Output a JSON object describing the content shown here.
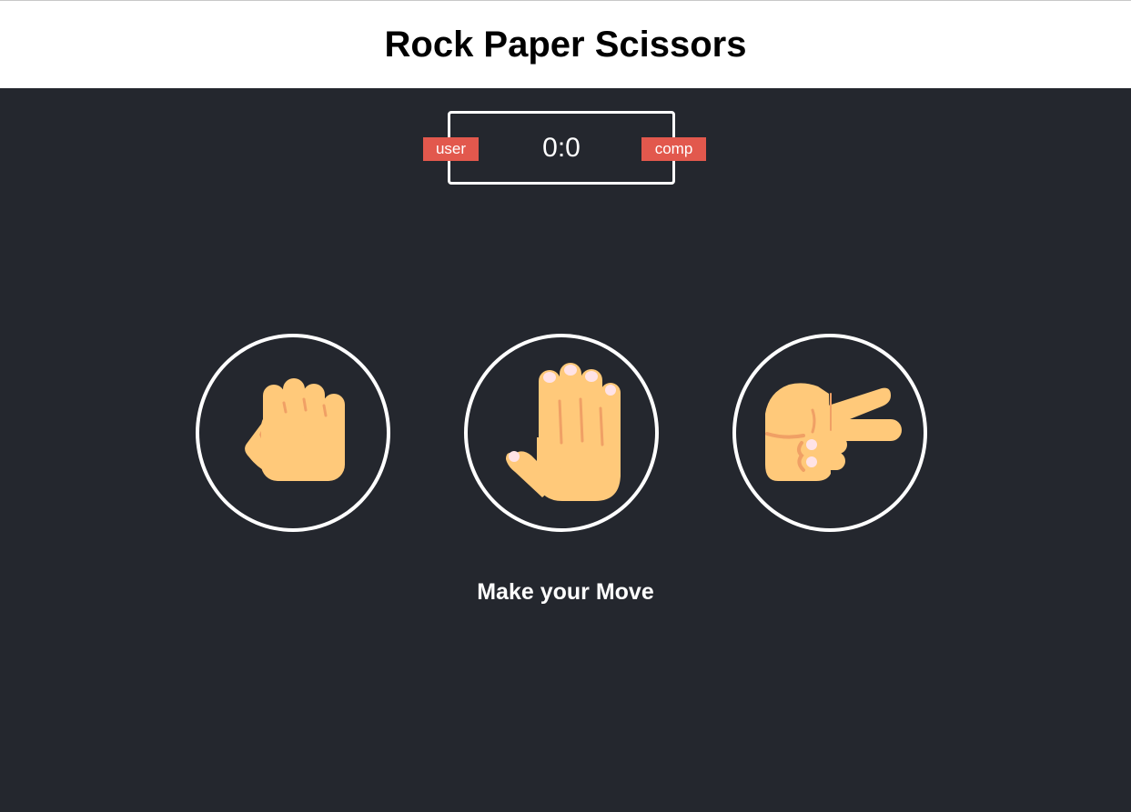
{
  "header": {
    "title": "Rock Paper Scissors"
  },
  "score_board": {
    "user_label": "user",
    "score": "0:0",
    "comp_label": "comp"
  },
  "choices": [
    {
      "id": "r",
      "icon": "fist-icon"
    },
    {
      "id": "p",
      "icon": "raised-hand-icon"
    },
    {
      "id": "s",
      "icon": "victory-hand-icon"
    }
  ],
  "result": {
    "message": "Make your Move"
  },
  "colors": {
    "background": "#24272e",
    "badge": "#e2584d",
    "skin": "#ffc97a",
    "skin_shadow": "#f0a065",
    "nail": "#ffe3e6"
  }
}
